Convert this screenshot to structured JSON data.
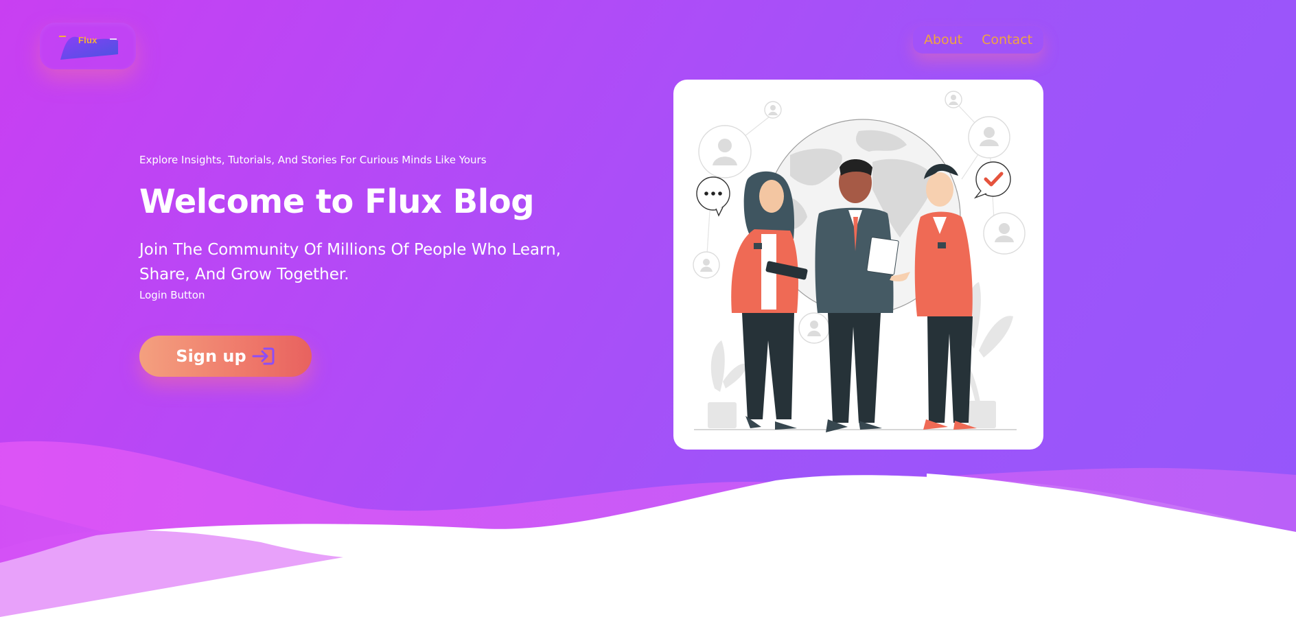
{
  "logo": {
    "text": "Flux"
  },
  "nav": {
    "about": "About",
    "contact": "Contact"
  },
  "hero": {
    "tagline": "Explore Insights, Tutorials, And Stories For Curious Minds Like Yours",
    "title": "Welcome to Flux Blog",
    "subtitle": "Join The Community Of Millions Of People Who Learn, Share, And Grow Together.",
    "login_label": "Login Button",
    "signup_label": "Sign up"
  },
  "colors": {
    "gradient_start": "#c93ff2",
    "gradient_end": "#9557fb",
    "nav_link": "#f0a53f",
    "button_start": "#f4a07f",
    "button_end": "#e8625f",
    "jacket": "#ef6a55",
    "suit": "#455a64"
  },
  "icons": {
    "logo": "flux-logo-icon",
    "signup": "login-arrow-icon"
  }
}
